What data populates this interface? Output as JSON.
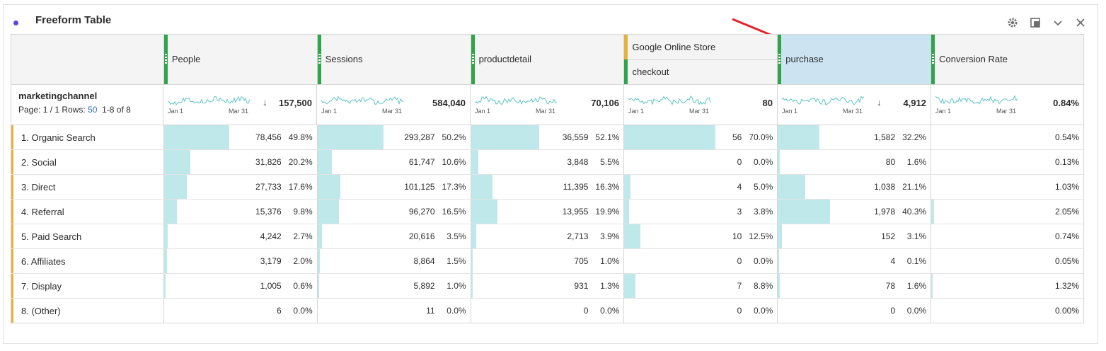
{
  "panel": {
    "title": "Freeform Table"
  },
  "dimension": {
    "name": "marketingchannel",
    "page_label": "Page: 1 / 1",
    "rows_label": "Rows:",
    "rows_value": "50",
    "range": "1-8 of 8"
  },
  "columns": [
    {
      "label": "People",
      "total": "157,500",
      "sorted": true,
      "bar_frac": [
        0.498,
        0.202,
        0.176,
        0.098,
        0.027,
        0.02,
        0.006,
        0.0
      ],
      "values": [
        "78,456",
        "31,826",
        "27,733",
        "15,376",
        "4,242",
        "3,179",
        "1,005",
        "6"
      ],
      "pcts": [
        "49.8%",
        "20.2%",
        "17.6%",
        "9.8%",
        "2.7%",
        "2.0%",
        "0.6%",
        "0.0%"
      ]
    },
    {
      "label": "Sessions",
      "total": "584,040",
      "sorted": false,
      "bar_frac": [
        0.502,
        0.106,
        0.173,
        0.165,
        0.035,
        0.015,
        0.01,
        0.0
      ],
      "values": [
        "293,287",
        "61,747",
        "101,125",
        "96,270",
        "20,616",
        "8,864",
        "5,892",
        "11"
      ],
      "pcts": [
        "50.2%",
        "10.6%",
        "17.3%",
        "16.5%",
        "3.5%",
        "1.5%",
        "1.0%",
        "0.0%"
      ]
    },
    {
      "label": "productdetail",
      "total": "70,106",
      "sorted": false,
      "bar_frac": [
        0.521,
        0.055,
        0.163,
        0.199,
        0.039,
        0.01,
        0.013,
        0.0
      ],
      "values": [
        "36,559",
        "3,848",
        "11,395",
        "13,955",
        "2,713",
        "705",
        "931",
        "0"
      ],
      "pcts": [
        "52.1%",
        "5.5%",
        "16.3%",
        "19.9%",
        "3.9%",
        "1.0%",
        "1.3%",
        "0.0%"
      ]
    },
    {
      "label_top": "Google Online Store",
      "label": "checkout",
      "total": "80",
      "sorted": false,
      "bar_frac": [
        0.7,
        0.0,
        0.05,
        0.038,
        0.125,
        0.0,
        0.088,
        0.0
      ],
      "values": [
        "56",
        "0",
        "4",
        "3",
        "10",
        "0",
        "7",
        "0"
      ],
      "pcts": [
        "70.0%",
        "0.0%",
        "5.0%",
        "3.8%",
        "12.5%",
        "0.0%",
        "8.8%",
        "0.0%"
      ]
    },
    {
      "label": "purchase",
      "total": "4,912",
      "sorted": true,
      "bar_frac": [
        0.322,
        0.016,
        0.211,
        0.403,
        0.031,
        0.001,
        0.016,
        0.0
      ],
      "values": [
        "1,582",
        "80",
        "1,038",
        "1,978",
        "152",
        "4",
        "78",
        "0"
      ],
      "pcts": [
        "32.2%",
        "1.6%",
        "21.1%",
        "40.3%",
        "3.1%",
        "0.1%",
        "1.6%",
        "0.0%"
      ]
    },
    {
      "label": "Conversion Rate",
      "total": "0.84%",
      "sorted": false,
      "bar_frac": [
        0.0,
        0.0,
        0.0,
        0.02,
        0.0,
        0.0,
        0.01,
        0.0
      ],
      "values": [
        "0.54%",
        "0.13%",
        "1.03%",
        "2.05%",
        "0.74%",
        "0.05%",
        "1.32%",
        "0.00%"
      ],
      "pcts": [
        "",
        "",
        "",
        "",
        "",
        "",
        "",
        ""
      ]
    }
  ],
  "rows": [
    "1. Organic Search",
    "2. Social",
    "3. Direct",
    "4. Referral",
    "5. Paid Search",
    "6. Affiliates",
    "7. Display",
    "8. (Other)"
  ],
  "sparkline": {
    "start_label": "Jan 1",
    "end_label": "Mar 31"
  },
  "colors": {
    "bar": "#bfe8ea",
    "spark": "#5ec4c8",
    "accent_green": "#2ea54a",
    "accent_yellow": "#e4b23b",
    "selected_header": "#cce4f2"
  }
}
